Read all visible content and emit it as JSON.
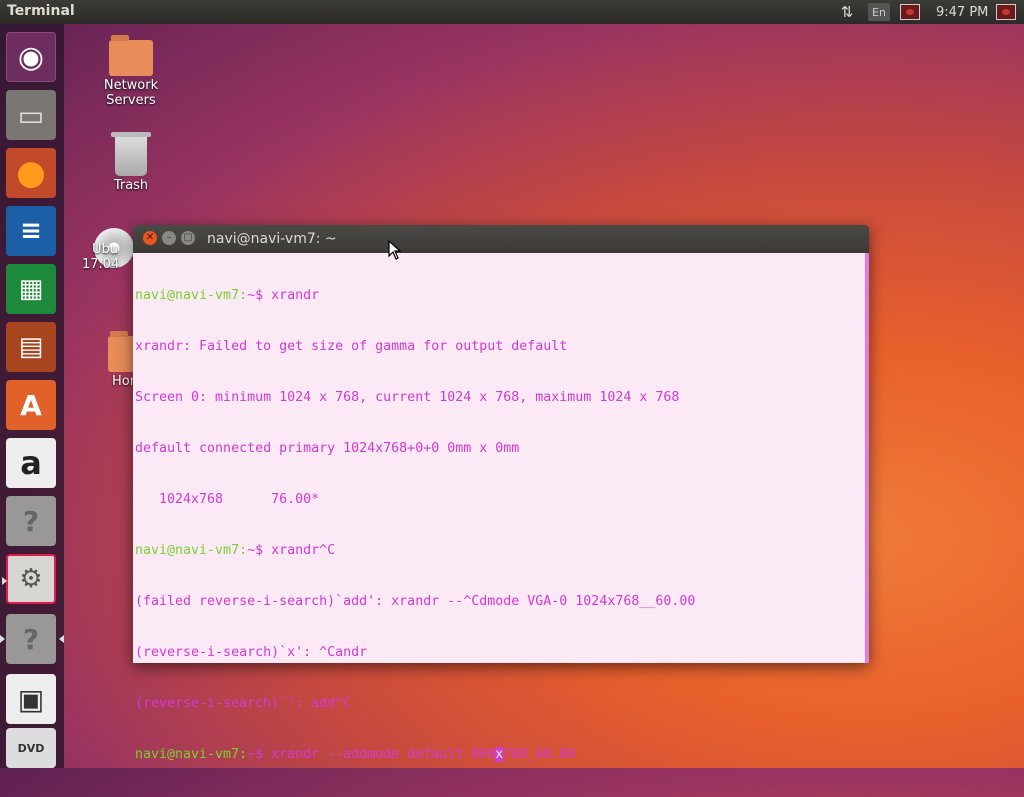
{
  "top_panel": {
    "app_title": "Terminal",
    "language": "En",
    "clock": "9:47 PM"
  },
  "launcher": {
    "items": [
      {
        "name": "ubuntu-dash",
        "glyph": "◉"
      },
      {
        "name": "files",
        "glyph": "▭"
      },
      {
        "name": "firefox",
        "glyph": "●"
      },
      {
        "name": "libreoffice-writer",
        "glyph": "≡"
      },
      {
        "name": "libreoffice-calc",
        "glyph": "▦"
      },
      {
        "name": "libreoffice-impress",
        "glyph": "▤"
      },
      {
        "name": "software-center",
        "glyph": "A"
      },
      {
        "name": "amazon",
        "glyph": "a"
      },
      {
        "name": "help",
        "glyph": "?"
      },
      {
        "name": "system-settings",
        "glyph": "⚙"
      },
      {
        "name": "help-2",
        "glyph": "?"
      },
      {
        "name": "floppy",
        "glyph": "▣"
      },
      {
        "name": "dvd",
        "glyph": "DVD"
      }
    ]
  },
  "desktop": {
    "network_servers": "Network\nServers",
    "trash": "Trash",
    "ubuntu_partial_1": "Ubu",
    "ubuntu_partial_2": "17.04",
    "home_partial": "Hon"
  },
  "terminal": {
    "title": "navi@navi-vm7: ~",
    "lines": [
      {
        "prompt": "navi@navi-vm7:",
        "path_and_cmd": "~$ xrandr"
      },
      {
        "text": "xrandr: Failed to get size of gamma for output default"
      },
      {
        "text": "Screen 0: minimum 1024 x 768, current 1024 x 768, maximum 1024 x 768"
      },
      {
        "text": "default connected primary 1024x768+0+0 0mm x 0mm"
      },
      {
        "text": "   1024x768      76.00*"
      },
      {
        "prompt": "navi@navi-vm7:",
        "path_and_cmd": "~$ xrandr^C"
      },
      {
        "text": "(failed reverse-i-search)`add': xrandr --^Cdmode VGA-0 1024x768__60.00"
      },
      {
        "text": "(reverse-i-search)`x': ^Candr"
      },
      {
        "text": "(reverse-i-search)`': add^C"
      }
    ],
    "current": {
      "prompt": "navi@navi-vm7:",
      "before_cursor": "~$ xrandr --addmode default 800",
      "cursor_char": "x",
      "after_cursor": "768_60.00"
    }
  }
}
